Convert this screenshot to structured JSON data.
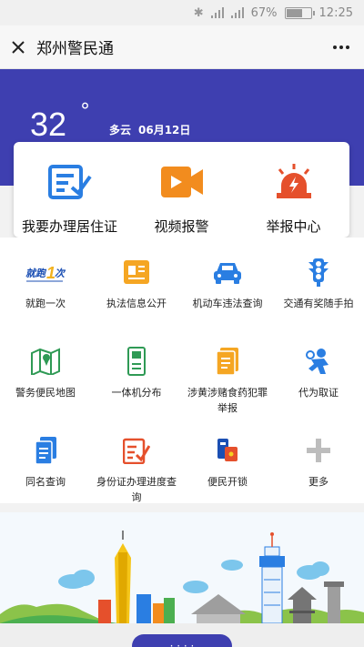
{
  "status_bar": {
    "battery": "67%",
    "time": "12:25",
    "battery_level": 0.67
  },
  "titlebar": {
    "title": "郑州警民通",
    "close_icon": "close-icon",
    "more_icon": "more-icon",
    "more_label": "···"
  },
  "header": {
    "temperature": "32",
    "degree": "°",
    "weather": "多云",
    "date": "06月12日"
  },
  "featured": [
    {
      "label": "我要办理居住证",
      "icon": "residence-permit-icon",
      "color": "#2a7ee2"
    },
    {
      "label": "视频报警",
      "icon": "video-camera-icon",
      "color": "#f28c1e"
    },
    {
      "label": "举报中心",
      "icon": "alarm-light-icon",
      "color": "#e5502c"
    }
  ],
  "services": [
    {
      "label": "就跑一次",
      "icon": "run-once-logo-icon",
      "logo_text": "就跑1次"
    },
    {
      "label": "执法信息公开",
      "icon": "news-icon"
    },
    {
      "label": "机动车违法查询",
      "icon": "car-icon"
    },
    {
      "label": "交通有奖随手拍",
      "icon": "traffic-light-icon"
    },
    {
      "label": "警务便民地图",
      "icon": "map-icon"
    },
    {
      "label": "一体机分布",
      "icon": "kiosk-icon"
    },
    {
      "label": "涉黄涉赌食药犯罪举报",
      "icon": "report-document-icon"
    },
    {
      "label": "代为取证",
      "icon": "evidence-person-icon"
    },
    {
      "label": "同名查询",
      "icon": "document-icon"
    },
    {
      "label": "身份证办理进度查询",
      "icon": "id-progress-icon"
    },
    {
      "label": "便民开锁",
      "icon": "unlock-icon"
    },
    {
      "label": "更多",
      "icon": "plus-icon"
    }
  ],
  "bottom_pill": {
    "label": "· · · ·"
  },
  "colors": {
    "brand": "#3e3fb0",
    "blue": "#2a7ee2",
    "orange": "#f28c1e",
    "red": "#e5502c",
    "green": "#2f9a55"
  }
}
